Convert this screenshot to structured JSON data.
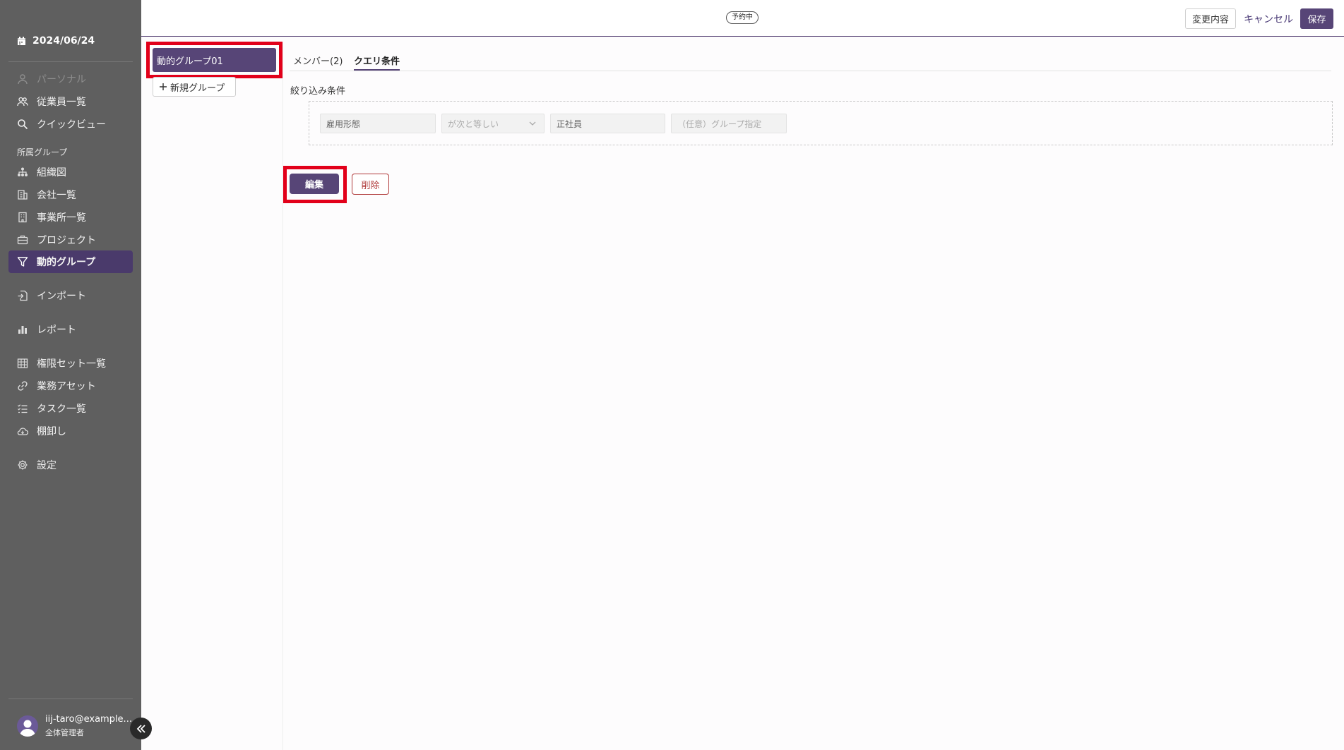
{
  "sidebar": {
    "date": "2024/06/24",
    "items": [
      {
        "label": "パーソナル",
        "icon": "person-icon",
        "state": "disabled"
      },
      {
        "label": "従業員一覧",
        "icon": "users-icon",
        "state": "normal"
      },
      {
        "label": "クイックビュー",
        "icon": "search-icon",
        "state": "normal"
      }
    ],
    "section_label": "所属グループ",
    "group_items": [
      {
        "label": "組織図",
        "icon": "org-chart-icon"
      },
      {
        "label": "会社一覧",
        "icon": "building-icon"
      },
      {
        "label": "事業所一覧",
        "icon": "office-icon"
      },
      {
        "label": "プロジェクト",
        "icon": "briefcase-icon"
      },
      {
        "label": "動的グループ",
        "icon": "filter-icon",
        "state": "active"
      }
    ],
    "import_label": "インポート",
    "report_label": "レポート",
    "admin_items": [
      {
        "label": "権限セット一覧",
        "icon": "grid-icon"
      },
      {
        "label": "業務アセット",
        "icon": "link-icon"
      },
      {
        "label": "タスク一覧",
        "icon": "task-list-icon"
      },
      {
        "label": "棚卸し",
        "icon": "cloud-icon"
      }
    ],
    "settings_label": "設定",
    "user": {
      "email": "iij-taro@example...",
      "role": "全体管理者"
    }
  },
  "header": {
    "status_badge": "予約中",
    "changes_label": "変更内容",
    "cancel_label": "キャンセル",
    "save_label": "保存"
  },
  "groups": {
    "selected": "動的グループ01",
    "new_group_label": "新規グループ"
  },
  "main": {
    "tabs": [
      {
        "label": "メンバー(2)",
        "active": false
      },
      {
        "label": "クエリ条件",
        "active": true
      }
    ],
    "filter_label": "絞り込み条件",
    "condition": {
      "field": "雇用形態",
      "operator": "が次と等しい",
      "value": "正社員",
      "group_placeholder": "（任意）グループ指定"
    },
    "edit_label": "編集",
    "delete_label": "削除"
  },
  "colors": {
    "accent": "#574577",
    "sidebar_bg": "#5f5f5f",
    "highlight": "#e2001a",
    "danger": "#b03a3a"
  }
}
